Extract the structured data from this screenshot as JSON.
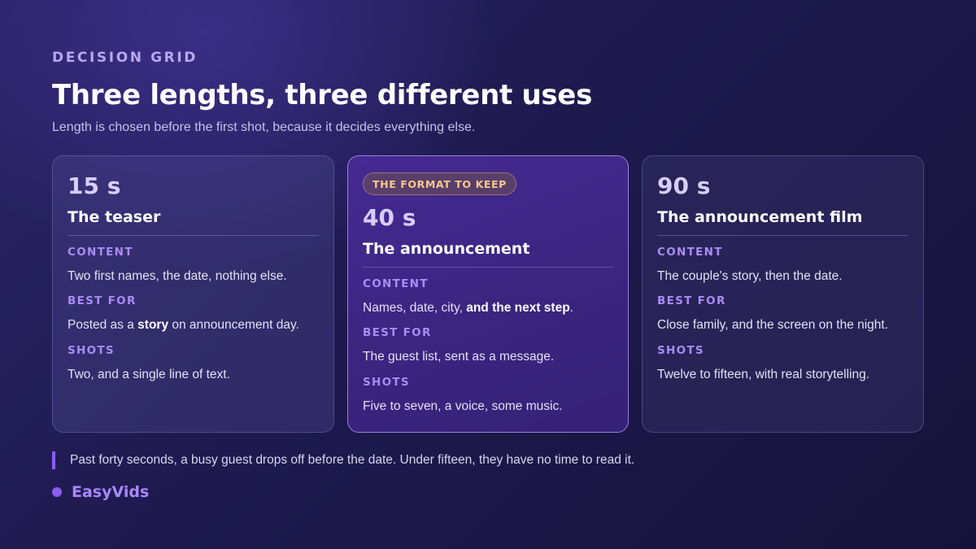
{
  "header": {
    "eyebrow": "DECISION GRID",
    "title": "Three lengths, three different uses",
    "subtitle": "Length is chosen before the first shot, because it decides everything else."
  },
  "cards": [
    {
      "duration": "15 s",
      "name": "The teaser",
      "content_label": "CONTENT",
      "content": "Two first names, the date, nothing else.",
      "best_for_label": "BEST FOR",
      "best_for_pre": "Posted as a ",
      "best_for_bold": "story",
      "best_for_post": " on announcement day.",
      "shots_label": "SHOTS",
      "shots": "Two, and a single line of text."
    },
    {
      "badge": "THE FORMAT TO KEEP",
      "duration": "40 s",
      "name": "The announcement",
      "content_label": "CONTENT",
      "content_pre": "Names, date, city, ",
      "content_bold": "and the next step",
      "content_post": ".",
      "best_for_label": "BEST FOR",
      "best_for": "The guest list, sent as a message.",
      "shots_label": "SHOTS",
      "shots": "Five to seven, a voice, some music."
    },
    {
      "duration": "90 s",
      "name": "The announcement film",
      "content_label": "CONTENT",
      "content": "The couple's story, then the date.",
      "best_for_label": "BEST FOR",
      "best_for": "Close family, and the screen on the night.",
      "shots_label": "SHOTS",
      "shots": "Twelve to fifteen, with real storytelling."
    }
  ],
  "note": "Past forty seconds, a busy guest drops off before the date. Under fifteen, they have no time to read it.",
  "brand": {
    "name": "EasyVids",
    "accent_color": "#8a5cf0"
  }
}
